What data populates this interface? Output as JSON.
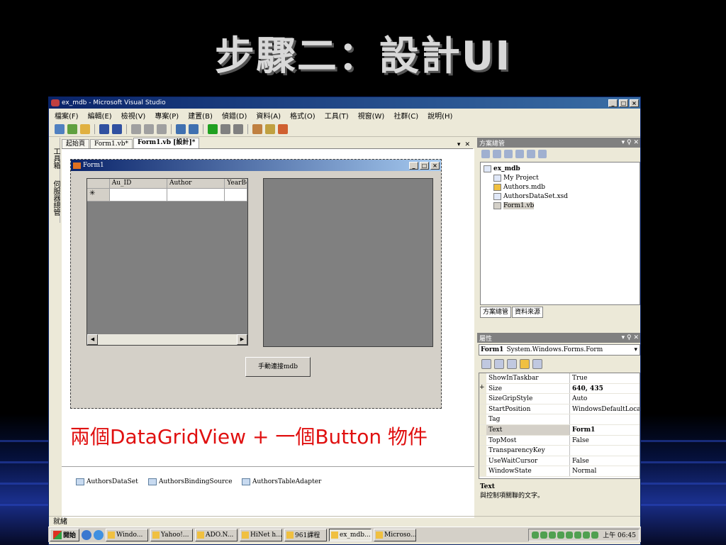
{
  "slide": {
    "title": "步驟二：設計UI",
    "annotation": "兩個DataGridView + 一個Button 物件"
  },
  "window": {
    "title": "ex_mdb - Microsoft Visual Studio",
    "menu": [
      "檔案(F)",
      "編輯(E)",
      "檢視(V)",
      "專案(P)",
      "建置(B)",
      "偵錯(D)",
      "資料(A)",
      "格式(O)",
      "工具(T)",
      "視窗(W)",
      "社群(C)",
      "說明(H)"
    ],
    "toolbox_label": "工具箱",
    "server_explorer_label": "伺服器總管",
    "doc_tabs": [
      "起始頁",
      "Form1.vb*",
      "Form1.vb [設計]*"
    ],
    "status": "就緒"
  },
  "form": {
    "title": "Form1",
    "grid_columns": [
      "Au_ID",
      "Author",
      "YearBo"
    ],
    "new_row_marker": "✳",
    "connect_button": "手動連接mdb"
  },
  "component_tray": [
    "AuthorsDataSet",
    "AuthorsBindingSource",
    "AuthorsTableAdapter"
  ],
  "solution_explorer": {
    "title": "方案總管",
    "pin": "▾ ♀ ✕",
    "root": "ex_mdb",
    "items": [
      "My Project",
      "Authors.mdb",
      "AuthorsDataSet.xsd",
      "Form1.vb"
    ],
    "tabs": [
      "方案總管",
      "資料來源"
    ]
  },
  "properties": {
    "title": "屬性",
    "object_name": "Form1",
    "object_type": "System.Windows.Forms.Form",
    "rows": [
      {
        "name": "ShowInTaskbar",
        "value": "True"
      },
      {
        "name": "Size",
        "value": "640, 435",
        "bold": true,
        "expand": "+"
      },
      {
        "name": "SizeGripStyle",
        "value": "Auto"
      },
      {
        "name": "StartPosition",
        "value": "WindowsDefaultLocati"
      },
      {
        "name": "Tag",
        "value": ""
      },
      {
        "name": "Text",
        "value": "Form1",
        "bold": true,
        "selected": true
      },
      {
        "name": "TopMost",
        "value": "False"
      },
      {
        "name": "TransparencyKey",
        "value": ""
      },
      {
        "name": "UseWaitCursor",
        "value": "False"
      },
      {
        "name": "WindowState",
        "value": "Normal"
      }
    ],
    "desc_title": "Text",
    "desc_text": "與控制項關聯的文字。"
  },
  "taskbar": {
    "start": "開始",
    "tasks": [
      "Windo...",
      "Yahoo!...",
      "ADO.N...",
      "HiNet h...",
      "961課程",
      "ex_mdb...",
      "Microso..."
    ],
    "active_index": 5,
    "clock": "上午 06:45"
  }
}
